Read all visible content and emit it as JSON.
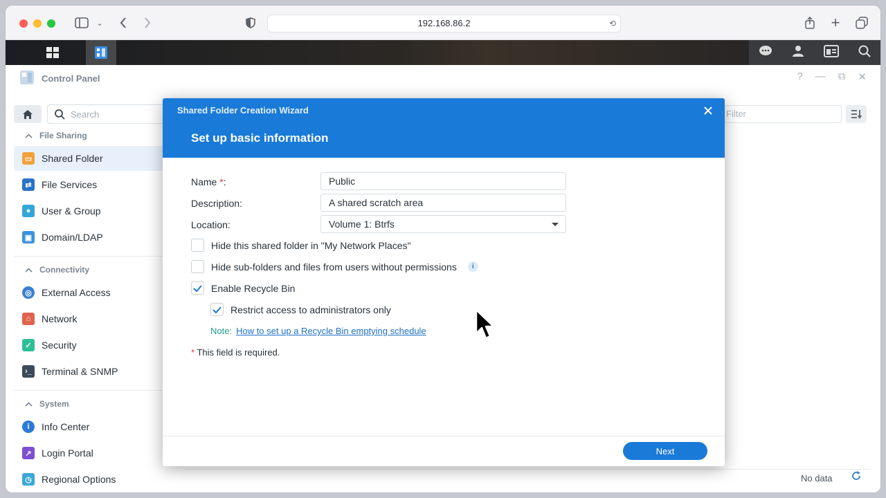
{
  "browser": {
    "url": "192.168.86.2"
  },
  "window": {
    "title": "Control Panel",
    "controls": [
      "?",
      "—",
      "⧉",
      "✕"
    ]
  },
  "sidebar": {
    "search_placeholder": "Search",
    "groups": [
      {
        "title": "File Sharing",
        "items": [
          {
            "label": "Shared Folder",
            "icon": "shared-folder-icon",
            "color": "#f0a23c",
            "selected": true
          },
          {
            "label": "File Services",
            "icon": "file-services-icon",
            "color": "#2b73c9"
          },
          {
            "label": "User & Group",
            "icon": "user-group-icon",
            "color": "#34a6d9"
          },
          {
            "label": "Domain/LDAP",
            "icon": "domain-ldap-icon",
            "color": "#3c92dc"
          }
        ]
      },
      {
        "title": "Connectivity",
        "items": [
          {
            "label": "External Access",
            "icon": "external-access-icon",
            "color": "#3a7fd4"
          },
          {
            "label": "Network",
            "icon": "network-icon",
            "color": "#e0634e"
          },
          {
            "label": "Security",
            "icon": "security-icon",
            "color": "#2fbf96"
          },
          {
            "label": "Terminal & SNMP",
            "icon": "terminal-icon",
            "color": "#3d4a5a"
          }
        ]
      },
      {
        "title": "System",
        "items": [
          {
            "label": "Info Center",
            "icon": "info-center-icon",
            "color": "#2d7ad6"
          },
          {
            "label": "Login Portal",
            "icon": "login-portal-icon",
            "color": "#7e4fd0"
          },
          {
            "label": "Regional Options",
            "icon": "regional-options-icon",
            "color": "#3aa8d8"
          }
        ]
      }
    ]
  },
  "main": {
    "filter_placeholder": "Filter",
    "status": "No data"
  },
  "wizard": {
    "window_title": "Shared Folder Creation Wizard",
    "heading": "Set up basic information",
    "fields": {
      "name_label": "Name",
      "name_required_mark": "*",
      "name_colon": ":",
      "name_value": "Public",
      "description_label": "Description:",
      "description_value": "A shared scratch area",
      "location_label": "Location:",
      "location_value": "Volume 1:  Btrfs"
    },
    "options": {
      "hide_network_places": {
        "label": "Hide this shared folder in \"My Network Places\"",
        "checked": false
      },
      "hide_subfolders": {
        "label": "Hide sub-folders and files from users without permissions",
        "checked": false
      },
      "enable_recycle_bin": {
        "label": "Enable Recycle Bin",
        "checked": true
      },
      "restrict_admins": {
        "label": "Restrict access to administrators only",
        "checked": true
      }
    },
    "note_label": "Note:",
    "note_link": "How to set up a Recycle Bin emptying schedule",
    "required_mark": "*",
    "required_text": "This field is required.",
    "next_label": "Next"
  },
  "colors": {
    "accent": "#1a7ad8",
    "required": "#e2384b",
    "note": "#1e9f8c"
  }
}
